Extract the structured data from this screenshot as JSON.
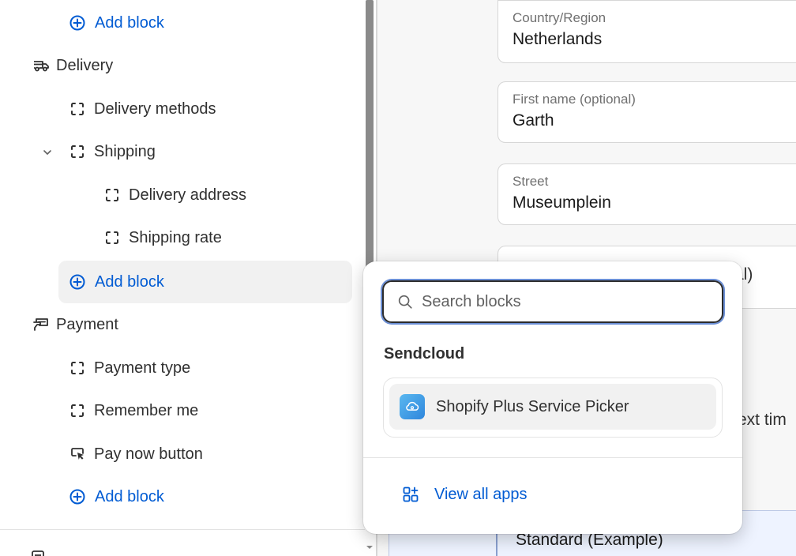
{
  "sidebar": {
    "add_block_label": "Add block",
    "sections": [
      {
        "label": "Delivery",
        "icon": "delivery-truck-icon"
      },
      {
        "label": "Payment",
        "icon": "payment-cash-icon"
      }
    ],
    "delivery_items": [
      {
        "label": "Delivery methods",
        "icon": "block-placeholder-icon"
      },
      {
        "label": "Shipping",
        "icon": "block-placeholder-icon",
        "expanded": true
      },
      {
        "label": "Delivery address",
        "icon": "block-placeholder-icon"
      },
      {
        "label": "Shipping rate",
        "icon": "block-placeholder-icon"
      }
    ],
    "payment_items": [
      {
        "label": "Payment type",
        "icon": "block-placeholder-icon"
      },
      {
        "label": "Remember me",
        "icon": "block-placeholder-icon"
      },
      {
        "label": "Pay now button",
        "icon": "cursor-click-icon"
      }
    ]
  },
  "preview": {
    "fields": [
      {
        "label": "Country/Region",
        "value": "Netherlands"
      },
      {
        "label": "First name (optional)",
        "value": "Garth"
      },
      {
        "label": "Street",
        "value": "Museumplein"
      }
    ],
    "partial_label": "al)",
    "partial_text": "ext tim",
    "standard_option": "Standard (Example)"
  },
  "popover": {
    "search_placeholder": "Search blocks",
    "group_title": "Sendcloud",
    "apps": [
      {
        "name": "Shopify Plus Service Picker",
        "icon": "cloud-app-icon"
      }
    ],
    "view_all_label": "View all apps"
  },
  "colors": {
    "accent": "#005bd3",
    "text": "#303030",
    "hover_bg": "#f1f1f1",
    "app_icon": "#3a9be6"
  }
}
